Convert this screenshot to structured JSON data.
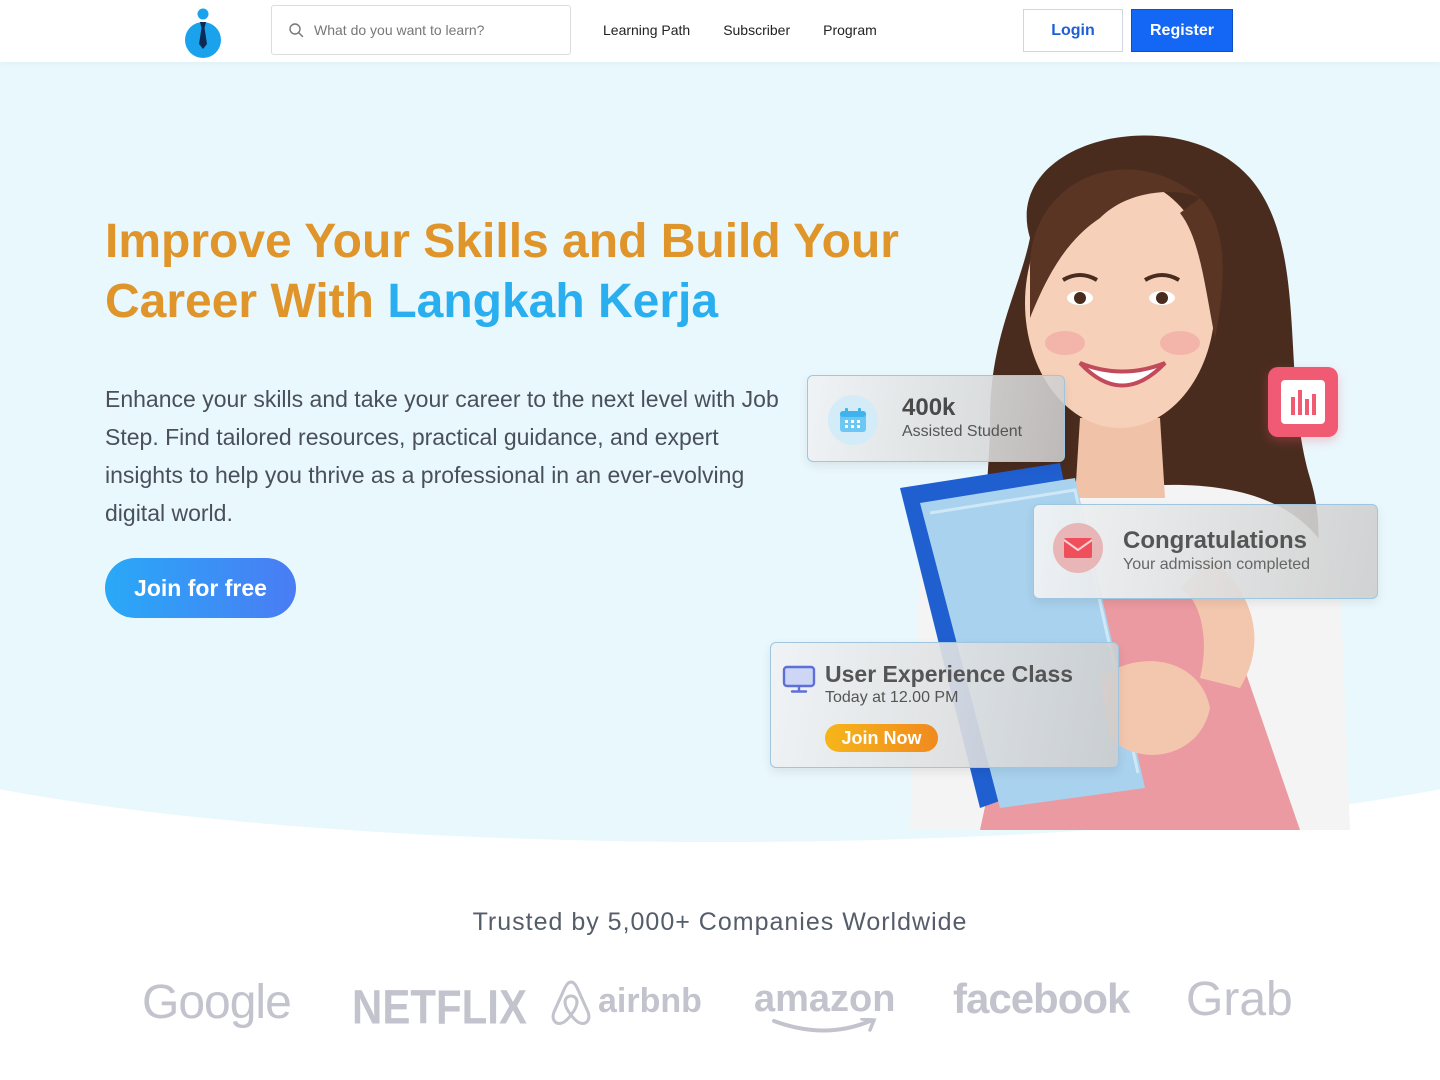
{
  "header": {
    "search_placeholder": "What do you want to learn?",
    "nav": [
      "Learning Path",
      "Subscriber",
      "Program"
    ],
    "login_label": "Login",
    "register_label": "Register"
  },
  "hero": {
    "title_line1": "Improve Your Skills and Build Your",
    "title_line2_prefix": "Career With ",
    "title_line2_accent": "Langkah Kerja",
    "description": "Enhance your skills and take your career to the next level with Job Step. Find tailored resources, practical guidance, and expert insights to help you thrive as a professional in an ever-evolving digital world.",
    "cta_label": "Join for free"
  },
  "cards": {
    "students": {
      "value": "400k",
      "label": "Assisted Student"
    },
    "congrats": {
      "title": "Congratulations",
      "subtitle": "Your admission completed"
    },
    "class": {
      "title": "User Experience Class",
      "time": "Today at 12.00 PM",
      "button": "Join Now"
    }
  },
  "trusted": {
    "heading": "Trusted by 5,000+ Companies Worldwide",
    "companies": [
      "Google",
      "NETFLIX",
      "airbnb",
      "amazon",
      "facebook",
      "Grab"
    ]
  },
  "colors": {
    "title_orange": "#e0952a",
    "accent_blue": "#29aef0",
    "primary_button": "#1466f5",
    "hero_bg": "#e9f8fd",
    "logo_gray": "#c2c3cd"
  }
}
